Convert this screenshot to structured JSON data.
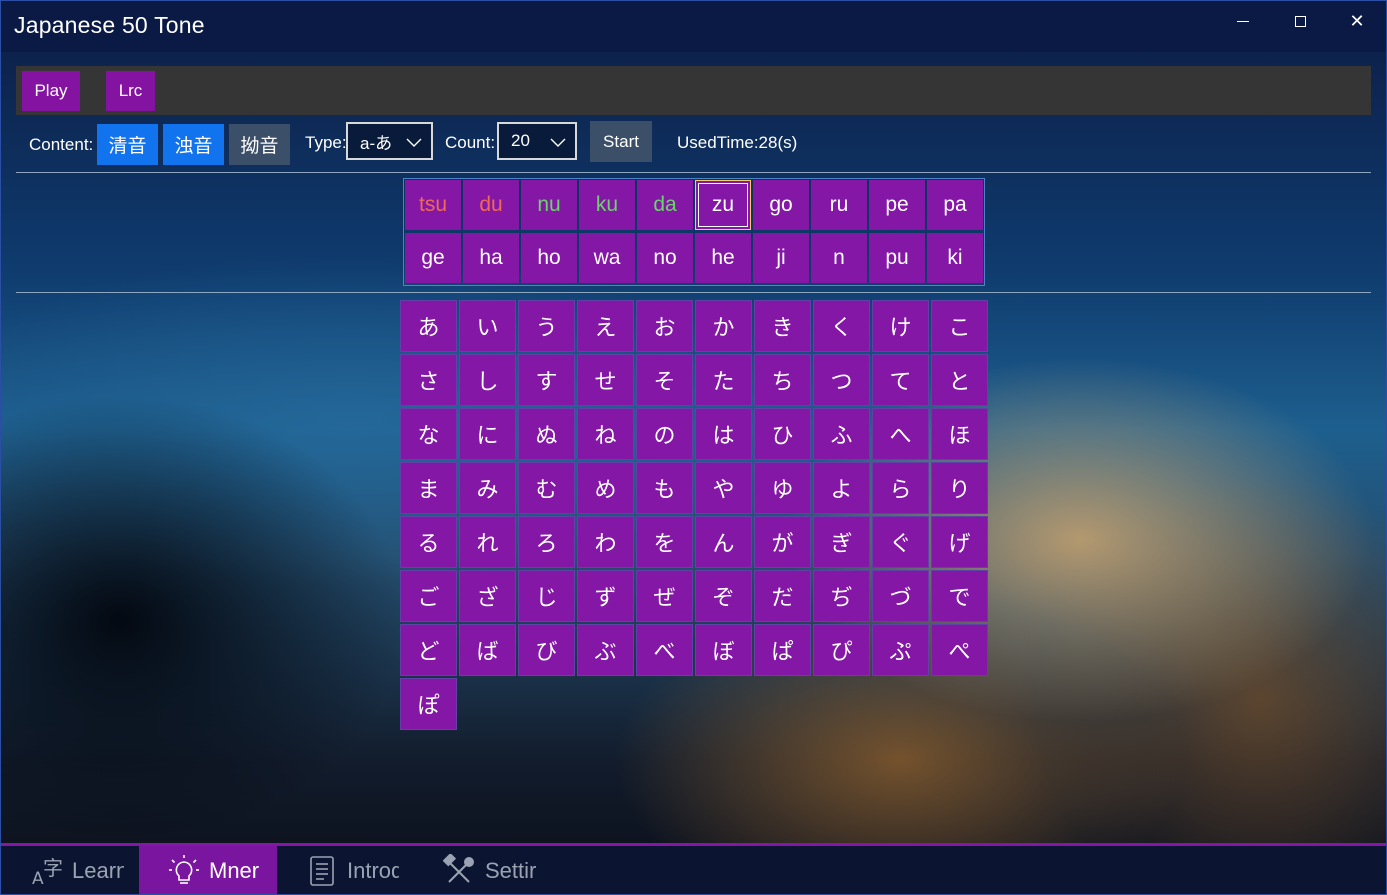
{
  "window": {
    "title": "Japanese 50 Tone",
    "minimize_icon": "minimize-icon",
    "maximize_icon": "maximize-icon",
    "close_icon": "close-icon",
    "close_glyph": "✕"
  },
  "toolbar": {
    "play_label": "Play",
    "lrc_label": "Lrc"
  },
  "options": {
    "content_label": "Content:",
    "content_chips": [
      {
        "label": "清音",
        "selected": true
      },
      {
        "label": "浊音",
        "selected": true
      },
      {
        "label": "拗音",
        "selected": false
      }
    ],
    "type_label": "Type:",
    "type_value": "a-あ",
    "count_label": "Count:",
    "count_value": "20",
    "start_label": "Start",
    "used_time": "UsedTime:28(s)"
  },
  "quiz": {
    "rows": [
      [
        {
          "text": "tsu",
          "state": "wrong"
        },
        {
          "text": "du",
          "state": "wrong"
        },
        {
          "text": "nu",
          "state": "right"
        },
        {
          "text": "ku",
          "state": "right"
        },
        {
          "text": "da",
          "state": "right"
        },
        {
          "text": "zu",
          "state": "current"
        },
        {
          "text": "go",
          "state": "pending"
        },
        {
          "text": "ru",
          "state": "pending"
        },
        {
          "text": "pe",
          "state": "pending"
        },
        {
          "text": "pa",
          "state": "pending"
        }
      ],
      [
        {
          "text": "ge",
          "state": "pending"
        },
        {
          "text": "ha",
          "state": "pending"
        },
        {
          "text": "ho",
          "state": "pending"
        },
        {
          "text": "wa",
          "state": "pending"
        },
        {
          "text": "no",
          "state": "pending"
        },
        {
          "text": "he",
          "state": "pending"
        },
        {
          "text": "ji",
          "state": "pending"
        },
        {
          "text": "n",
          "state": "pending"
        },
        {
          "text": "pu",
          "state": "pending"
        },
        {
          "text": "ki",
          "state": "pending"
        }
      ]
    ],
    "colors": {
      "wrong": "#ef6a54",
      "right": "#6bd36c",
      "cell": "#8417a6"
    }
  },
  "kana": [
    "あ",
    "い",
    "う",
    "え",
    "お",
    "か",
    "き",
    "く",
    "け",
    "こ",
    "さ",
    "し",
    "す",
    "せ",
    "そ",
    "た",
    "ち",
    "つ",
    "て",
    "と",
    "な",
    "に",
    "ぬ",
    "ね",
    "の",
    "は",
    "ひ",
    "ふ",
    "へ",
    "ほ",
    "ま",
    "み",
    "む",
    "め",
    "も",
    "や",
    "ゆ",
    "よ",
    "ら",
    "り",
    "る",
    "れ",
    "ろ",
    "わ",
    "を",
    "ん",
    "が",
    "ぎ",
    "ぐ",
    "げ",
    "ご",
    "ざ",
    "じ",
    "ず",
    "ぜ",
    "ぞ",
    "だ",
    "ぢ",
    "づ",
    "で",
    "ど",
    "ば",
    "び",
    "ぶ",
    "べ",
    "ぼ",
    "ぱ",
    "ぴ",
    "ぷ",
    "ぺ",
    "ぽ"
  ],
  "nav": [
    {
      "label": "Learn",
      "icon": "learn-icon",
      "active": false
    },
    {
      "label": "Mner",
      "icon": "lightbulb-icon",
      "active": true
    },
    {
      "label": "Introd",
      "icon": "scroll-icon",
      "active": false
    },
    {
      "label": "Settir",
      "icon": "tools-icon",
      "active": false
    }
  ],
  "nav_learn_glyph_a": "A",
  "nav_learn_glyph_zi": "字",
  "accent_color": "#8417a6",
  "chip_selected_color": "#1173ee"
}
